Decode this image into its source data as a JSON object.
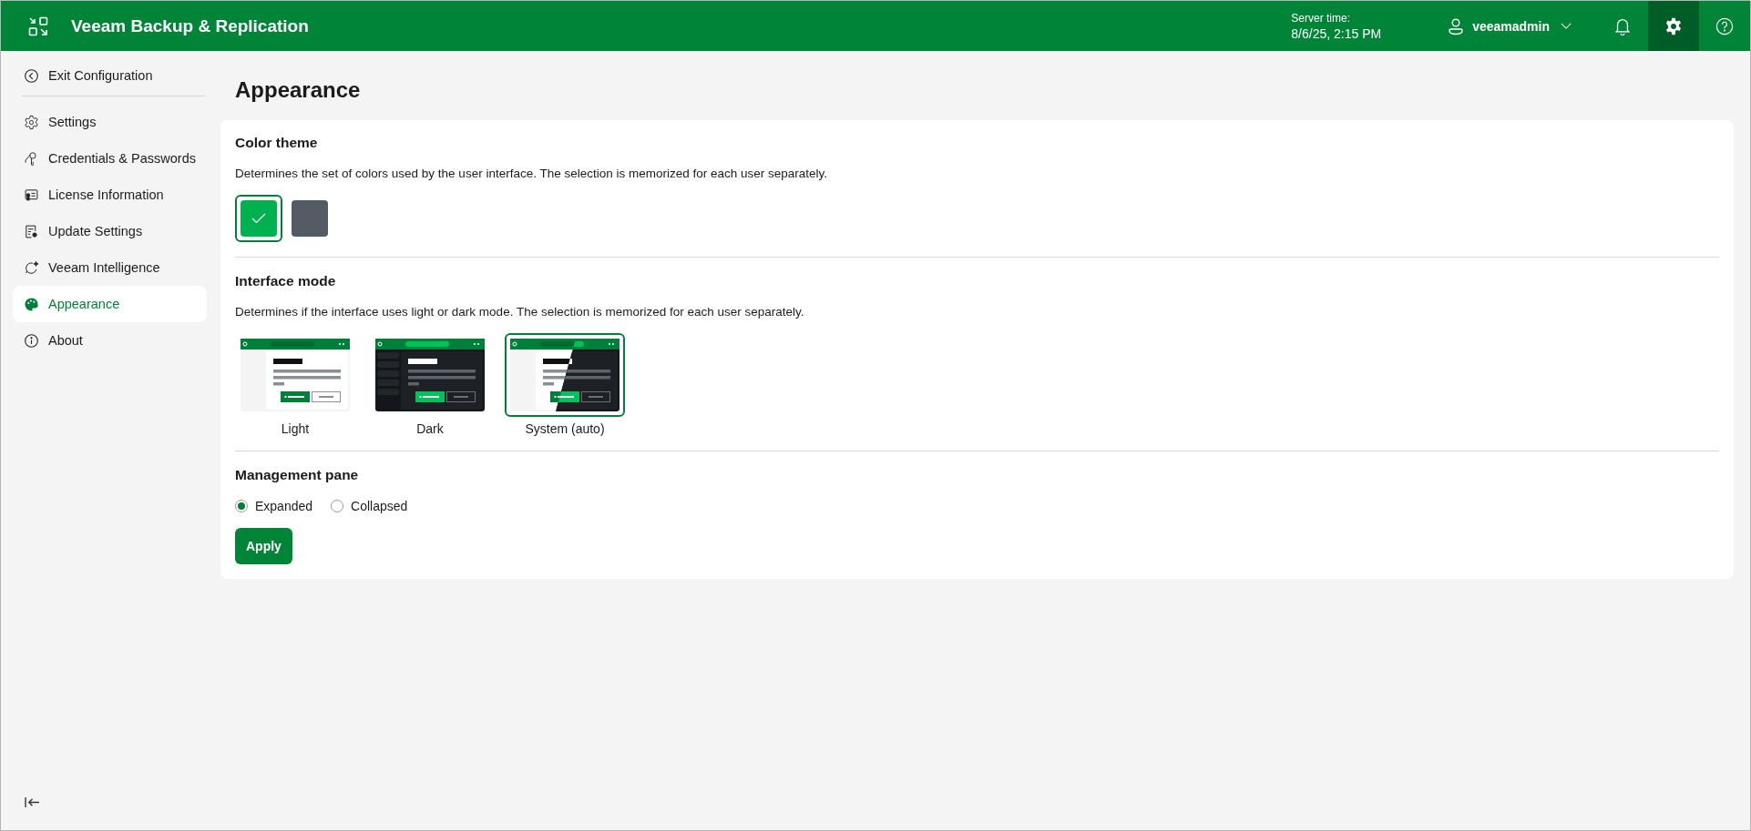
{
  "header": {
    "title": "Veeam Backup & Replication",
    "server_time_label": "Server time:",
    "server_time": "8/6/25, 2:15 PM",
    "user": "veeamadmin"
  },
  "sidebar": {
    "exit": "Exit Configuration",
    "items": [
      {
        "label": "Settings",
        "kind": "settings",
        "selected": false
      },
      {
        "label": "Credentials & Passwords",
        "kind": "credentials",
        "selected": false
      },
      {
        "label": "License Information",
        "kind": "license",
        "selected": false
      },
      {
        "label": "Update Settings",
        "kind": "update",
        "selected": false
      },
      {
        "label": "Veeam Intelligence",
        "kind": "intelligence",
        "selected": false
      },
      {
        "label": "Appearance",
        "kind": "appearance",
        "selected": true
      },
      {
        "label": "About",
        "kind": "about",
        "selected": false
      }
    ]
  },
  "page_title": "Appearance",
  "color_theme": {
    "heading": "Color theme",
    "description": "Determines the set of colors used by the user interface. The selection is memorized for each user separately.",
    "swatches": [
      {
        "color": "#00b14f",
        "selected": true
      },
      {
        "color": "#545b64",
        "selected": false
      }
    ]
  },
  "interface_mode": {
    "heading": "Interface mode",
    "description": "Determines if the interface uses light or dark mode. The selection is memorized for each user separately.",
    "options": [
      {
        "label": "Light",
        "kind": "light",
        "selected": false
      },
      {
        "label": "Dark",
        "kind": "dark",
        "selected": false
      },
      {
        "label": "System (auto)",
        "kind": "system",
        "selected": true
      }
    ]
  },
  "management_pane": {
    "heading": "Management pane",
    "options": [
      {
        "label": "Expanded",
        "selected": true
      },
      {
        "label": "Collapsed",
        "selected": false
      }
    ]
  },
  "apply_button": "Apply"
}
